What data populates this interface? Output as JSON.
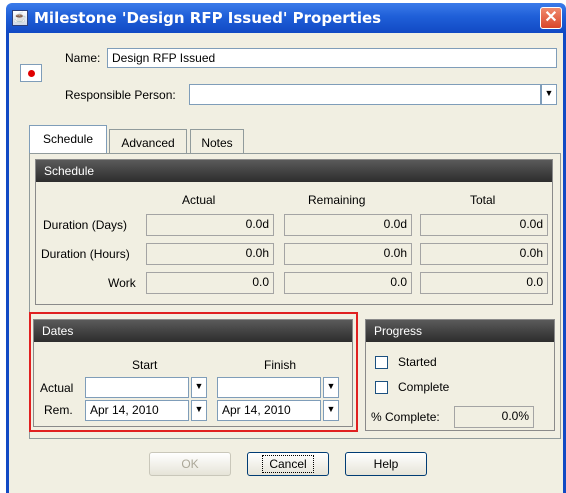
{
  "window": {
    "title": "Milestone 'Design RFP Issued' Properties",
    "icon": "java-cup-icon",
    "close_glyph": "✕"
  },
  "name_field": {
    "label": "Name:",
    "value": "Design RFP Issued"
  },
  "responsible": {
    "label": "Responsible Person:",
    "value": ""
  },
  "tabs": [
    {
      "label": "Schedule",
      "active": true
    },
    {
      "label": "Advanced",
      "active": false
    },
    {
      "label": "Notes",
      "active": false
    }
  ],
  "schedule": {
    "header": "Schedule",
    "columns": [
      "Actual",
      "Remaining",
      "Total"
    ],
    "rows": [
      {
        "label": "Duration (Days)",
        "values": [
          "0.0d",
          "0.0d",
          "0.0d"
        ]
      },
      {
        "label": "Duration (Hours)",
        "values": [
          "0.0h",
          "0.0h",
          "0.0h"
        ]
      },
      {
        "label": "Work",
        "values": [
          "0.0",
          "0.0",
          "0.0"
        ]
      }
    ]
  },
  "dates": {
    "header": "Dates",
    "start_label": "Start",
    "finish_label": "Finish",
    "actual_label": "Actual",
    "rem_label": "Rem.",
    "actual_start": "",
    "actual_finish": "",
    "rem_start": "Apr 14, 2010",
    "rem_finish": "Apr 14, 2010",
    "highlight_color": "#e02020"
  },
  "progress": {
    "header": "Progress",
    "started_label": "Started",
    "complete_label": "Complete",
    "percent_label": "% Complete:",
    "percent_value": "0.0%"
  },
  "buttons": {
    "ok": "OK",
    "cancel": "Cancel",
    "help": "Help"
  },
  "dropdown_glyph": "▼",
  "colors": {
    "title_bar": "#1f5fd8",
    "dialog_bg": "#f1efe2",
    "panel_header": "#3a3a3a"
  }
}
